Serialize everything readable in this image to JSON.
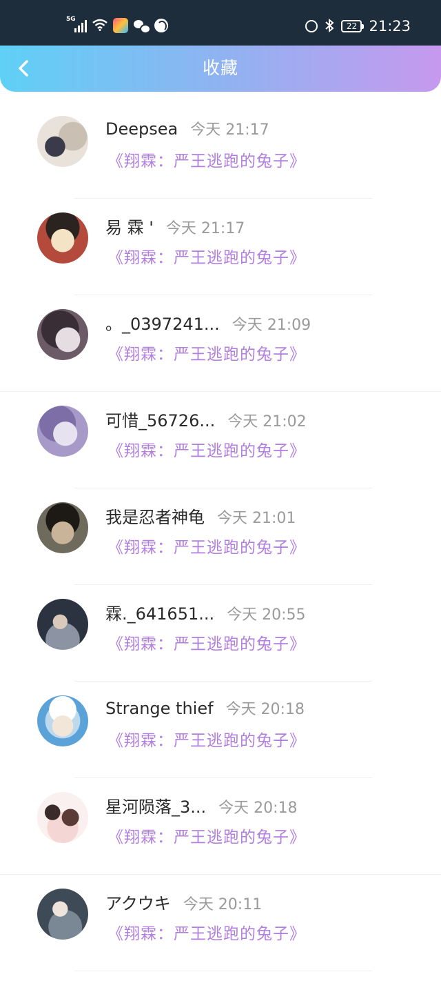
{
  "status_bar": {
    "network": "5G",
    "battery": "22",
    "time": "21:23"
  },
  "header": {
    "title": "收藏"
  },
  "items": [
    {
      "name": "Deepsea",
      "time": "今天 21:17",
      "quote": "《翔霖：严王逃跑的兔子》",
      "avatar_colors": [
        "#e8e2da",
        "#3a3a4a"
      ]
    },
    {
      "name": "易 霖 '",
      "time": "今天 21:17",
      "quote": "《翔霖：严王逃跑的兔子》",
      "avatar_colors": [
        "#b44a3c",
        "#f5e3c6"
      ]
    },
    {
      "name": "。_0397241...",
      "time": "今天 21:09",
      "quote": "《翔霖：严王逃跑的兔子》",
      "avatar_colors": [
        "#6c5b66",
        "#e5dde2"
      ]
    },
    {
      "name": "可惜_56726...",
      "time": "今天 21:02",
      "quote": "《翔霖：严王逃跑的兔子》",
      "avatar_colors": [
        "#a89ac8",
        "#e6e2f0"
      ]
    },
    {
      "name": "我是忍者神龟",
      "time": "今天 21:01",
      "quote": "《翔霖：严王逃跑的兔子》",
      "avatar_colors": [
        "#3b3d33",
        "#a99c86"
      ]
    },
    {
      "name": "霖._641651...",
      "time": "今天 20:55",
      "quote": "《翔霖：严王逃跑的兔子》",
      "avatar_colors": [
        "#2c3340",
        "#b9c0cc"
      ]
    },
    {
      "name": "Strange thief",
      "time": "今天 20:18",
      "quote": "《翔霖：严王逃跑的兔子》",
      "avatar_colors": [
        "#5aa2d8",
        "#eef4fb"
      ]
    },
    {
      "name": "星河陨落_3...",
      "time": "今天 20:18",
      "quote": "《翔霖：严王逃跑的兔子》",
      "avatar_colors": [
        "#e6b9bf",
        "#faf0ef"
      ]
    },
    {
      "name": "アクウキ",
      "time": "今天 20:11",
      "quote": "《翔霖：严王逃跑的兔子》",
      "avatar_colors": [
        "#3e4a55",
        "#d6dbe0"
      ]
    }
  ]
}
